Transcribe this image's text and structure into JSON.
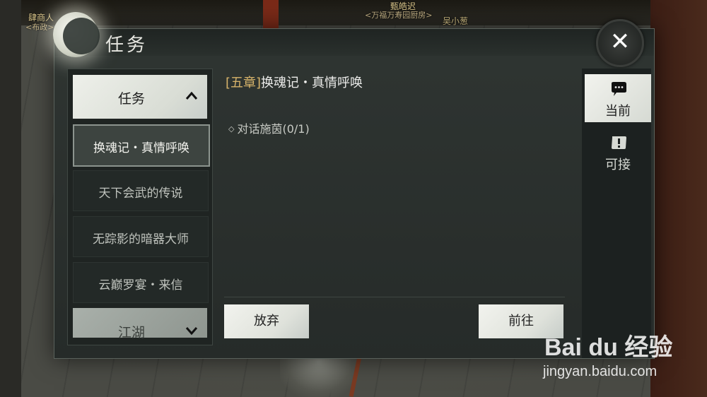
{
  "world": {
    "npc1_name": "甄皓迟",
    "npc1_title": "<万福万寿园厨房>",
    "npc2_name": "吴小葱",
    "npc3_name": "肆商人",
    "npc3_title": "<布政>"
  },
  "panel": {
    "title": "任务",
    "close_label": "✕"
  },
  "quest_list": {
    "category_open": "任务",
    "category_closed": "江湖",
    "items": [
      {
        "label": "换魂记・真情呼唤",
        "selected": true
      },
      {
        "label": "天下会武的传说",
        "selected": false
      },
      {
        "label": "无踪影的暗器大师",
        "selected": false
      },
      {
        "label": "云巅罗宴・来信",
        "selected": false
      }
    ]
  },
  "detail": {
    "chapter": "[五章]",
    "title": "换魂记・真情呼唤",
    "objective": "对话施茵(0/1)"
  },
  "actions": {
    "abandon": "放弃",
    "go": "前往"
  },
  "tabs": [
    {
      "label": "当前",
      "icon": "scroll-speech-icon",
      "active": true
    },
    {
      "label": "可接",
      "icon": "scroll-exclaim-icon",
      "active": false
    }
  ],
  "watermark": {
    "brand": "Bai du 经验",
    "url": "jingyan.baidu.com"
  },
  "colors": {
    "accent_gold": "#d7b36a",
    "panel_bg": "#2f3532"
  }
}
